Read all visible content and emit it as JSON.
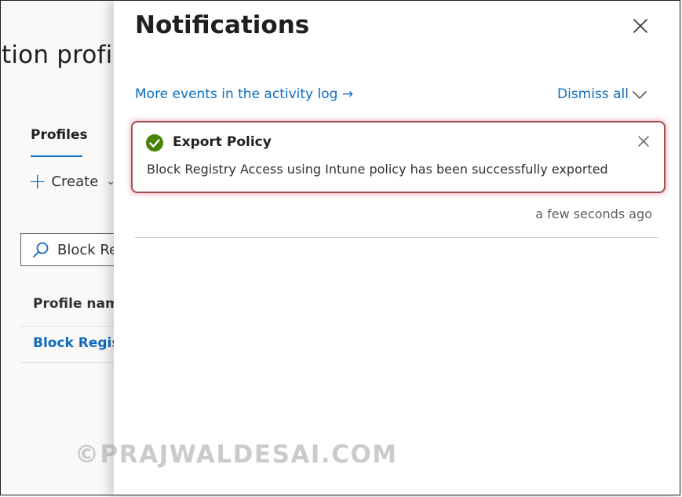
{
  "background_page": {
    "title_partial": "tion profile",
    "tab_label": "Profiles",
    "create_label": "Create",
    "search_value": "Block Re",
    "column_header": "Profile name",
    "row_link": "Block Registr"
  },
  "notifications": {
    "title": "Notifications",
    "activity_link": "More events in the activity log →",
    "dismiss_all_label": "Dismiss all",
    "items": [
      {
        "title": "Export Policy",
        "message": "Block Registry Access using Intune policy has been successfully exported",
        "timestamp": "a few seconds ago",
        "status": "success"
      }
    ]
  },
  "watermark": "©PRAJWALDESAI.COM",
  "colors": {
    "accent": "#0f6cbd",
    "success": "#498205",
    "highlight_border": "#a0524a"
  },
  "icons": {
    "close": "close-icon",
    "dismiss_chevron": "chevron-down-icon",
    "success": "check-circle-icon",
    "search": "search-icon",
    "create": "plus-icon"
  }
}
